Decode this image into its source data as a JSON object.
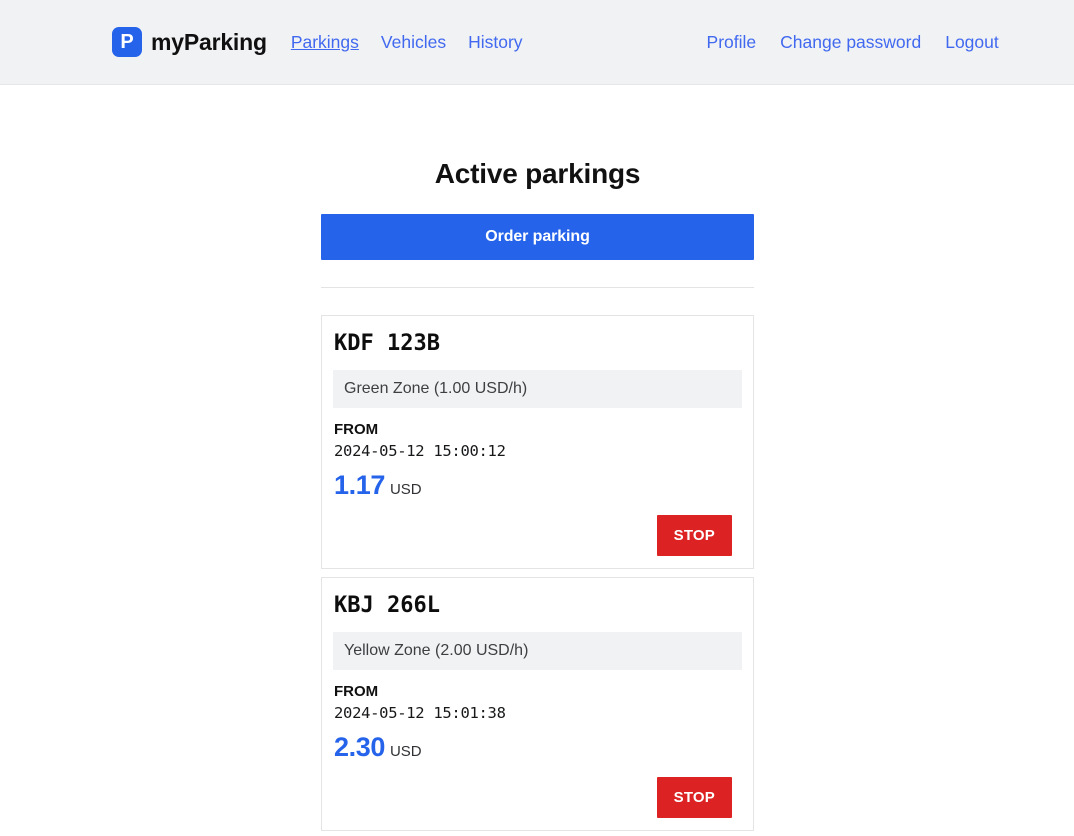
{
  "header": {
    "brand": {
      "logo_letter": "P",
      "logo_icon": "parking-logo-icon",
      "name": "myParking",
      "logo_color": "#2563eb"
    },
    "nav_left": [
      {
        "label": "Parkings",
        "active": true
      },
      {
        "label": "Vehicles",
        "active": false
      },
      {
        "label": "History",
        "active": false
      }
    ],
    "nav_right": [
      {
        "label": "Profile"
      },
      {
        "label": "Change password"
      },
      {
        "label": "Logout"
      }
    ],
    "link_color": "#4169f0"
  },
  "main": {
    "title": "Active parkings",
    "order_button_label": "Order parking",
    "order_button_color": "#2563eb",
    "from_label": "FROM",
    "stop_button_label": "STOP",
    "stop_button_color": "#dc2222",
    "amount_color": "#2563eb",
    "parkings": [
      {
        "plate": "KDF  123B",
        "zone": "Green Zone (1.00 USD/h)",
        "from_label": "FROM",
        "from_time": "2024-05-12 15:00:12",
        "amount": "1.17",
        "currency": "USD",
        "stop_label": "STOP"
      },
      {
        "plate": "KBJ  266L",
        "zone": "Yellow Zone (2.00 USD/h)",
        "from_label": "FROM",
        "from_time": "2024-05-12 15:01:38",
        "amount": "2.30",
        "currency": "USD",
        "stop_label": "STOP"
      }
    ]
  }
}
